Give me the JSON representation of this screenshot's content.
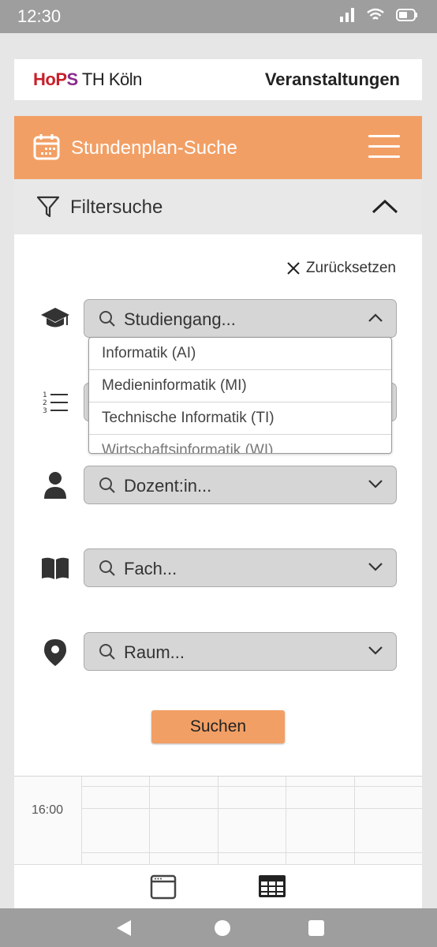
{
  "status": {
    "time": "12:30"
  },
  "header": {
    "logo_h": "H",
    "logo_o": "o",
    "logo_p": "P",
    "logo_s": "S",
    "logo_rest": " TH Köln",
    "title": "Veranstaltungen"
  },
  "toolbar": {
    "title": "Stundenplan-Suche"
  },
  "filter": {
    "title": "Filtersuche",
    "reset_label": "Zurücksetzen"
  },
  "fields": {
    "studiengang": "Studiengang...",
    "semester": "",
    "dozent": "Dozent:in...",
    "fach": "Fach...",
    "raum": "Raum..."
  },
  "dropdown": {
    "options": [
      "Informatik (AI)",
      "Medieninformatik (MI)",
      "Technische Informatik (TI)",
      "Wirtschaftsinformatik (WI)"
    ]
  },
  "search_button": "Suchen",
  "timetable": {
    "time_label": "16:00"
  },
  "colors": {
    "accent": "#f29f65",
    "header_text": "#222222"
  }
}
